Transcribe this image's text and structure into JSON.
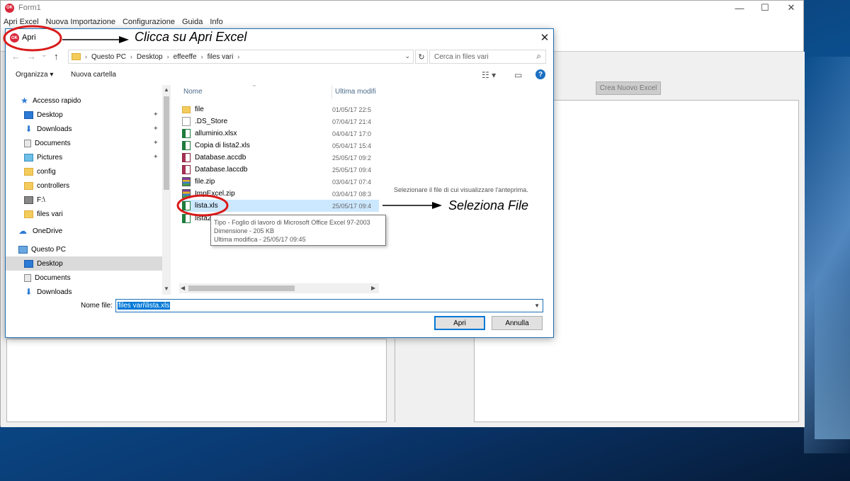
{
  "app": {
    "title": "Form1",
    "icon_text": "OK",
    "menu": [
      "Apri Excel",
      "Nuova Importazione",
      "Configurazione",
      "Guida",
      "Info"
    ],
    "window_controls": {
      "minimize": "—",
      "maximize": "☐",
      "close": "✕"
    },
    "crea_button": "Crea Nuovo Excel"
  },
  "dialog": {
    "title": "Apri",
    "close": "✕",
    "nav": {
      "back": "←",
      "forward": "→",
      "down": "⌄",
      "up": "↑"
    },
    "breadcrumb": [
      "Questo PC",
      "Desktop",
      "effeeffe",
      "files vari"
    ],
    "crumb_sep": "›",
    "dropdown": "⌄",
    "refresh": "↻",
    "search_placeholder": "Cerca in files vari",
    "search_icon": "⌕",
    "organizza": "Organizza ▾",
    "nuova_cartella": "Nuova cartella",
    "view_icon": "☷ ▾",
    "pane_icon": "▭",
    "help_icon": "?",
    "nav_items": [
      {
        "label": "Accesso rapido",
        "icon": "star-icon",
        "pinned": false
      },
      {
        "label": "Desktop",
        "icon": "desktop-icon",
        "pinned": true
      },
      {
        "label": "Downloads",
        "icon": "download-icon",
        "pinned": true
      },
      {
        "label": "Documents",
        "icon": "document-icon",
        "pinned": true
      },
      {
        "label": "Pictures",
        "icon": "picture-icon",
        "pinned": true
      },
      {
        "label": "config",
        "icon": "folder-icon",
        "pinned": false
      },
      {
        "label": "controllers",
        "icon": "folder-icon",
        "pinned": false
      },
      {
        "label": "F:\\",
        "icon": "drive-icon",
        "pinned": false
      },
      {
        "label": "files vari",
        "icon": "folder-icon",
        "pinned": false
      },
      {
        "label": "OneDrive",
        "icon": "cloud-icon",
        "pinned": false
      },
      {
        "label": "Questo PC",
        "icon": "computer-icon",
        "pinned": false
      },
      {
        "label": "Desktop",
        "icon": "desktop-icon",
        "pinned": false
      },
      {
        "label": "Documents",
        "icon": "document-icon",
        "pinned": false
      },
      {
        "label": "Downloads",
        "icon": "download-icon",
        "pinned": false
      }
    ],
    "pin_icon": "📌",
    "columns": {
      "name": "Nome",
      "modified": "Ultima modifi"
    },
    "files": [
      {
        "name": "file",
        "date": "01/05/17 22:5",
        "type": "folder"
      },
      {
        "name": ".DS_Store",
        "date": "07/04/17 21:4",
        "type": "blank"
      },
      {
        "name": "alluminio.xlsx",
        "date": "04/04/17 17:0",
        "type": "xls"
      },
      {
        "name": "Copia di lista2.xls",
        "date": "05/04/17 15:4",
        "type": "xls"
      },
      {
        "name": "Database.accdb",
        "date": "25/05/17 09:2",
        "type": "db"
      },
      {
        "name": "Database.laccdb",
        "date": "25/05/17 09:4",
        "type": "db"
      },
      {
        "name": "file.zip",
        "date": "03/04/17 07:4",
        "type": "zip"
      },
      {
        "name": "ImpExcel.zip",
        "date": "03/04/17 08:3",
        "type": "zip"
      },
      {
        "name": "lista.xls",
        "date": "25/05/17 09:4",
        "type": "xls"
      },
      {
        "name": "lista2",
        "date": "",
        "type": "xls"
      }
    ],
    "tooltip": [
      "Tipo - Foglio di lavoro di Microsoft Office Excel 97-2003",
      "Dimensione - 205 KB",
      "Ultima modifica - 25/05/17 09:45"
    ],
    "preview_text": "Selezionare il file di cui visualizzare l'anteprima.",
    "filename_label": "Nome file:",
    "filename_value": "files vari\\lista.xls",
    "open_button": "Apri",
    "cancel_button": "Annulla"
  },
  "annotations": {
    "open_excel": "Clicca su Apri Excel",
    "select_file": "Seleziona File"
  },
  "colors": {
    "accent": "#0078d7",
    "selection": "#cce8ff",
    "annotation": "#d91a1a"
  }
}
